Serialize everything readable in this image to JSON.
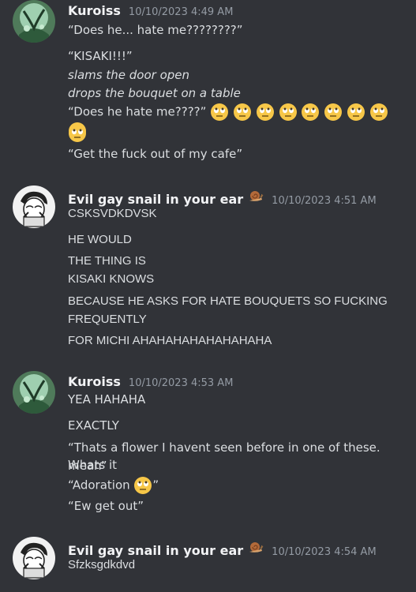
{
  "messages": [
    {
      "username": "Kuroiss",
      "timestamp": "10/10/2023 4:49 AM",
      "lines": [
        "“Does he... hate me????????”",
        "“KISAKI!!!”",
        "slams the door open",
        "drops the bouquet on a table",
        "“Does he hate me????”",
        "“Get the fuck out of my cafe”"
      ]
    },
    {
      "username": "Evil gay snail in your ear",
      "timestamp": "10/10/2023 4:51 AM",
      "lines": [
        "CSKSVDKDVSK",
        "HE WOULD",
        "THE THING IS",
        "KISAKI KNOWS",
        "BECAUSE HE ASKS FOR HATE BOUQUETS SO FUCKING",
        "FREQUENTLY",
        "FOR MICHI AHAHAHAHAHAHAHAHA"
      ]
    },
    {
      "username": "Kuroiss",
      "timestamp": "10/10/2023 4:53 AM",
      "lines": [
        "YEA HAHAHA",
        "EXACTLY",
        "“Thats a flower I havent seen before in one of these. Whats it",
        "mean”",
        "“Adoration ",
        "”",
        "“Ew get out”"
      ]
    },
    {
      "username": "Evil gay snail in your ear",
      "timestamp": "10/10/2023 4:54 AM",
      "lines": [
        "Sfzksgdkdvd"
      ]
    }
  ],
  "emoji": {
    "rolling_eyes": "face-with-rolling-eyes-emoji",
    "snail": "snail-emoji"
  },
  "colors": {
    "background": "#313338",
    "username": "#f2f3f5",
    "timestamp": "#949ba4",
    "text": "#dbdee1"
  }
}
